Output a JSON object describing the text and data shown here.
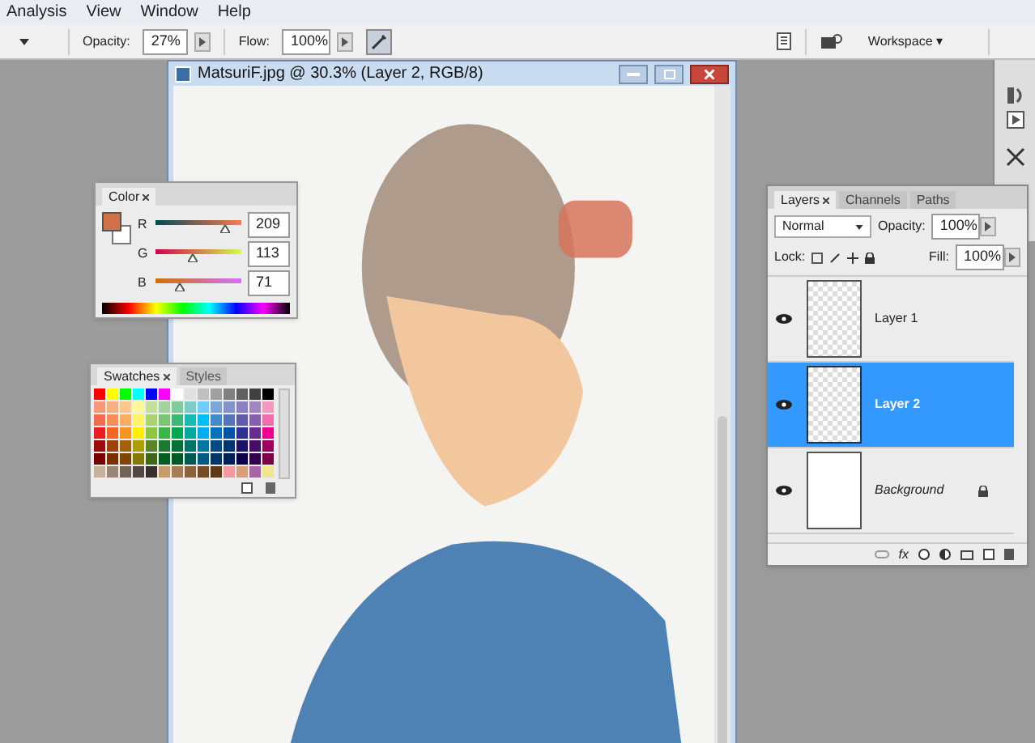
{
  "menu": [
    "Analysis",
    "View",
    "Window",
    "Help"
  ],
  "options_bar": {
    "opacity_label": "Opacity:",
    "opacity": "27%",
    "flow_label": "Flow:",
    "flow": "100%",
    "workspace": "Workspace ▾"
  },
  "document": {
    "title": "MatsuriF.jpg @ 30.3% (Layer 2, RGB/8)"
  },
  "color_panel": {
    "tab": "Color",
    "channels": [
      {
        "label": "R",
        "value": "209",
        "level": 0.82
      },
      {
        "label": "G",
        "value": "113",
        "level": 0.44
      },
      {
        "label": "B",
        "value": "71",
        "level": 0.28
      }
    ]
  },
  "swatches_panel": {
    "tabs": [
      {
        "label": "Swatches",
        "selected": true
      },
      {
        "label": "Styles",
        "selected": false
      }
    ],
    "rows": [
      [
        {
          "color": "#ff0000"
        },
        {
          "color": "#ffff00"
        },
        {
          "color": "#00ff00"
        },
        {
          "color": "#00ffff"
        },
        {
          "color": "#0000ff"
        },
        {
          "color": "#ff00ff"
        },
        {
          "color": "#ffffff"
        },
        {
          "color": "#e0e0e0"
        },
        {
          "color": "#c0c0c0"
        },
        {
          "color": "#a0a0a0"
        },
        {
          "color": "#808080"
        },
        {
          "color": "#606060"
        },
        {
          "color": "#404040"
        },
        {
          "color": "#000000"
        }
      ],
      [
        {
          "color": "#f7977a"
        },
        {
          "color": "#f9ad81"
        },
        {
          "color": "#fdc68a"
        },
        {
          "color": "#fff79a"
        },
        {
          "color": "#c4df9b"
        },
        {
          "color": "#a3d39c"
        },
        {
          "color": "#82ca9d"
        },
        {
          "color": "#7bcdc8"
        },
        {
          "color": "#6ecff6"
        },
        {
          "color": "#7ea7d8"
        },
        {
          "color": "#8493ca"
        },
        {
          "color": "#8882be"
        },
        {
          "color": "#a187be"
        },
        {
          "color": "#f49ac2"
        }
      ],
      [
        {
          "color": "#f26c4f"
        },
        {
          "color": "#f68e55"
        },
        {
          "color": "#fbaf5c"
        },
        {
          "color": "#fff467"
        },
        {
          "color": "#acd372"
        },
        {
          "color": "#7cc576"
        },
        {
          "color": "#3bb878"
        },
        {
          "color": "#1abbb4"
        },
        {
          "color": "#00bff3"
        },
        {
          "color": "#438ccb"
        },
        {
          "color": "#5574b9"
        },
        {
          "color": "#605ca8"
        },
        {
          "color": "#855fa8"
        },
        {
          "color": "#f06ea9"
        }
      ],
      [
        {
          "color": "#ed1c24"
        },
        {
          "color": "#f26522"
        },
        {
          "color": "#f7941d"
        },
        {
          "color": "#fff200"
        },
        {
          "color": "#8dc73f"
        },
        {
          "color": "#39b54a"
        },
        {
          "color": "#00a651"
        },
        {
          "color": "#00a99d"
        },
        {
          "color": "#00aeef"
        },
        {
          "color": "#0072bc"
        },
        {
          "color": "#0054a5"
        },
        {
          "color": "#2e3192"
        },
        {
          "color": "#662d91"
        },
        {
          "color": "#ec008c"
        }
      ],
      [
        {
          "color": "#9e0b0f"
        },
        {
          "color": "#a0410d"
        },
        {
          "color": "#a36209"
        },
        {
          "color": "#aba000"
        },
        {
          "color": "#598527"
        },
        {
          "color": "#1a7b30"
        },
        {
          "color": "#007236"
        },
        {
          "color": "#00746b"
        },
        {
          "color": "#0076a3"
        },
        {
          "color": "#004b80"
        },
        {
          "color": "#003471"
        },
        {
          "color": "#1b1464"
        },
        {
          "color": "#440e62"
        },
        {
          "color": "#9e005d"
        }
      ],
      [
        {
          "color": "#790000"
        },
        {
          "color": "#7b2e00"
        },
        {
          "color": "#7d4900"
        },
        {
          "color": "#827b00"
        },
        {
          "color": "#406618"
        },
        {
          "color": "#005e20"
        },
        {
          "color": "#005826"
        },
        {
          "color": "#005952"
        },
        {
          "color": "#005b7f"
        },
        {
          "color": "#003663"
        },
        {
          "color": "#002157"
        },
        {
          "color": "#0d004c"
        },
        {
          "color": "#32004b"
        },
        {
          "color": "#7b0046"
        }
      ],
      [
        {
          "color": "#c7b299"
        },
        {
          "color": "#998675"
        },
        {
          "color": "#736357"
        },
        {
          "color": "#534741"
        },
        {
          "color": "#37302d"
        },
        {
          "color": "#c69c6d"
        },
        {
          "color": "#a67c52"
        },
        {
          "color": "#8c6239"
        },
        {
          "color": "#754c24"
        },
        {
          "color": "#603913"
        },
        {
          "color": "#f5989d"
        },
        {
          "color": "#d8a07a"
        },
        {
          "color": "#a864a8"
        },
        {
          "color": "#f0e68c"
        }
      ]
    ]
  },
  "layers_panel": {
    "tabs": [
      {
        "label": "Layers",
        "selected": true
      },
      {
        "label": "Channels",
        "selected": false
      },
      {
        "label": "Paths",
        "selected": false
      }
    ],
    "footer_fx": "fx",
    "blend_mode": "Normal",
    "opacity_label": "Opacity:",
    "opacity": "100%",
    "lock_label": "Lock:",
    "fill_label": "Fill:",
    "fill": "100%",
    "layers": [
      {
        "name": "Layer 1",
        "visible": true,
        "selected": false,
        "locked": false,
        "kind": "transparent"
      },
      {
        "name": "Layer 2",
        "visible": true,
        "selected": true,
        "locked": false,
        "kind": "transparent"
      },
      {
        "name": "Background",
        "visible": true,
        "selected": false,
        "locked": true,
        "kind": "background"
      }
    ]
  }
}
